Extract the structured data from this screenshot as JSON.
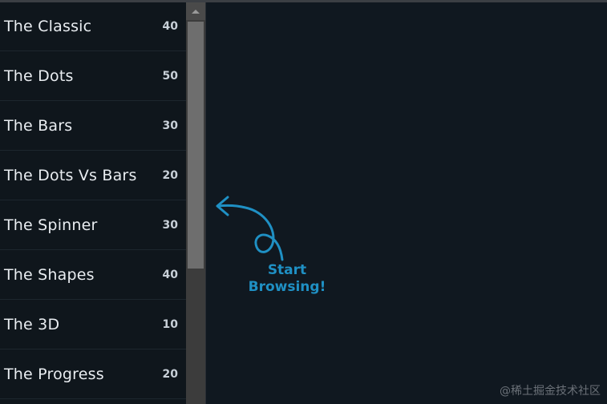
{
  "sidebar": {
    "items": [
      {
        "label": "The Classic",
        "count": "40"
      },
      {
        "label": "The Dots",
        "count": "50"
      },
      {
        "label": "The Bars",
        "count": "30"
      },
      {
        "label": "The Dots Vs Bars",
        "count": "20"
      },
      {
        "label": "The Spinner",
        "count": "30"
      },
      {
        "label": "The Shapes",
        "count": "40"
      },
      {
        "label": "The 3D",
        "count": "10"
      },
      {
        "label": "The Progress",
        "count": "20"
      }
    ]
  },
  "hint": {
    "line1": "Start",
    "line2": "Browsing!"
  },
  "watermark": "@稀土掘金技术社区",
  "colors": {
    "background": "#101820",
    "sidebar": "#0f161c",
    "accent": "#1f90c4",
    "text": "#e9edf1"
  },
  "icons": {
    "hint": "curly-arrow-icon",
    "scroll_up": "triangle-up-icon"
  }
}
